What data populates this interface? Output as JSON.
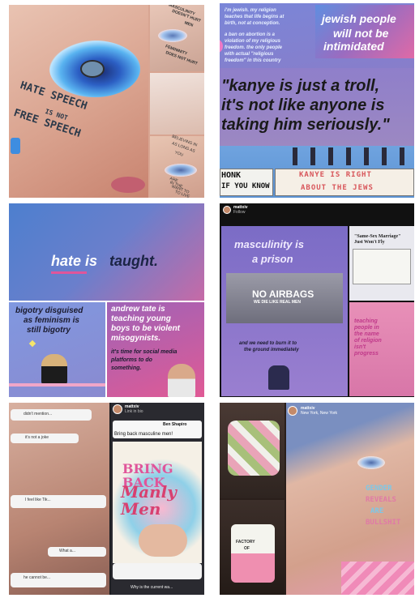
{
  "colors": {
    "pink": "#e0559a",
    "blue": "#3e7fc2",
    "purple": "#8a78c8",
    "skin": "#e6b9a6",
    "dark": "#222222"
  },
  "tile1": {
    "face_text": [
      "HATE SPEECH",
      "IS NOT",
      "FREE SPEECH"
    ],
    "strip1": [
      "MASCULINITY",
      "DOESN'T HURT",
      "MEN",
      "FEMININITY",
      "DOES NOT HURT"
    ],
    "strip3": [
      "BELIEVING IN",
      "AS LONG AS",
      "YOU",
      "ARE",
      "IN THE",
      "WANT TO",
      "TO LIVE"
    ]
  },
  "tile2": {
    "top_text": [
      "i'm jewish. my religion",
      "teaches that life begins at",
      "birth, not at conception.",
      "a ban on abortion is a",
      "violation of my religious",
      "freedom. the only people",
      "with actual \"religious",
      "freedom\" in this country"
    ],
    "badge": [
      "jewish people",
      "will not be",
      "intimidated"
    ],
    "quote": [
      "\"kanye is just a troll,",
      "it's not like anyone is",
      "taking him seriously.\""
    ],
    "sign_left": [
      "HONK",
      "IF YOU KNOW"
    ],
    "sign_right": [
      "KANYE IS RIGHT",
      "ABOUT THE JEWS"
    ]
  },
  "tile3": {
    "hate_word": "hate is",
    "taught_word": "taught.",
    "bigotry": [
      "bigotry disguised",
      "as feminism is",
      "still bigotry"
    ],
    "tate": [
      "andrew tate is",
      "teaching young",
      "boys to be violent",
      "misogynists."
    ],
    "tate_sub": [
      "it's time for social media",
      "platforms to do",
      "something."
    ]
  },
  "tile4": {
    "username": "mattxiv",
    "followers": "Follow",
    "masc": [
      "masculinity is",
      "a prison"
    ],
    "airbags": "NO AIRBAGS",
    "airbags_sub": "WE DIE LIKE REAL MEN",
    "ground": [
      "and we need to burn it to",
      "the ground immediately"
    ],
    "news_title": [
      "\"Same-Sex Marriage\"",
      "Just Won't Fly"
    ],
    "pink_post": [
      "teaching",
      "people in",
      "the name",
      "of religion",
      "isn't",
      "progress"
    ]
  },
  "tile5": {
    "username": "mattxiv",
    "sub": "Link in bio",
    "ben": "Ben Shapiro",
    "bring": "Bring back masculine men!",
    "banner": [
      "BRING BACK",
      "Manly Men"
    ],
    "comments": [
      "didn't mention...",
      "it's not a joke",
      "I feel like Tik...",
      "What a...",
      "he cannot be..."
    ],
    "why": "Why is the current wa..."
  },
  "tile6": {
    "username": "mattxiv",
    "location": "New York, New York",
    "face_words": [
      "GENDER",
      "REVEALS",
      "ARE",
      "BULLSHIT"
    ],
    "cake_text": [
      "FACTORY",
      "OF"
    ]
  }
}
